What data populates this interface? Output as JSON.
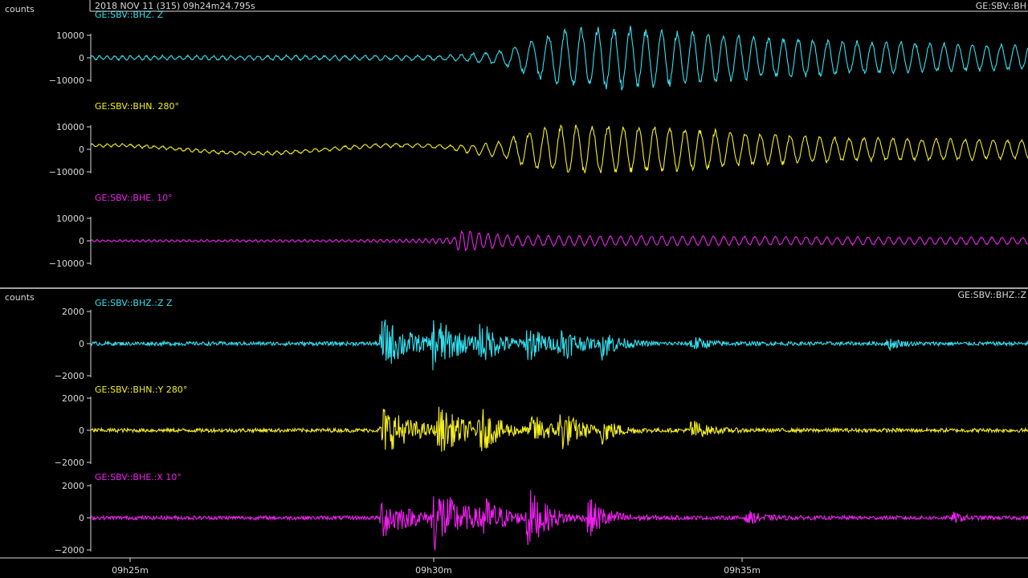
{
  "top_panel": {
    "units_label": "counts",
    "header_left": "2018 NOV 11 (315)  09h24m24.795s",
    "header_right": "GE:SBV::BH"
  },
  "bottom_panel": {
    "units_label": "counts",
    "header_right": "GE:SBV::BHZ.:Z"
  },
  "colors": {
    "background": "#000000",
    "axis": "#d8d8d8",
    "z": "#33e0f0",
    "n": "#f4ee20",
    "e": "#f020f0"
  },
  "chart_data": [
    {
      "type": "line",
      "panel": "top",
      "x_axis": "time",
      "series": [
        {
          "name": "GE:SBV::BHZ. Z",
          "color_key": "z",
          "ylim": [
            -14000,
            14000
          ],
          "yticks": [
            10000,
            0,
            -10000
          ],
          "ytick_labels": [
            "10000",
            "0",
            "−10000"
          ],
          "noise_amplitude": 800,
          "envelope": [
            [
              0,
              800
            ],
            [
              0.38,
              1000
            ],
            [
              0.4,
              1500
            ],
            [
              0.44,
              3000
            ],
            [
              0.46,
              6000
            ],
            [
              0.5,
              11500
            ],
            [
              0.55,
              13000
            ],
            [
              0.6,
              12000
            ],
            [
              0.7,
              9000
            ],
            [
              0.8,
              7000
            ],
            [
              0.9,
              6000
            ],
            [
              1.0,
              5000
            ]
          ],
          "period": [
            [
              0,
              0.008
            ],
            [
              0.4,
              0.012
            ],
            [
              0.46,
              0.018
            ],
            [
              0.7,
              0.016
            ],
            [
              1.0,
              0.015
            ]
          ]
        },
        {
          "name": "GE:SBV::BHN. 280°",
          "color_key": "n",
          "ylim": [
            -14000,
            14000
          ],
          "yticks": [
            10000,
            0,
            -10000
          ],
          "ytick_labels": [
            "10000",
            "0",
            "−10000"
          ],
          "noise_amplitude": 600,
          "long_period_amplitude": 3000,
          "envelope": [
            [
              0,
              600
            ],
            [
              0.38,
              800
            ],
            [
              0.41,
              2000
            ],
            [
              0.44,
              3500
            ],
            [
              0.47,
              8000
            ],
            [
              0.52,
              10500
            ],
            [
              0.6,
              9500
            ],
            [
              0.7,
              7000
            ],
            [
              0.8,
              5000
            ],
            [
              0.9,
              4500
            ],
            [
              1.0,
              4000
            ]
          ],
          "period": [
            [
              0,
              0.008
            ],
            [
              0.4,
              0.012
            ],
            [
              0.46,
              0.017
            ],
            [
              0.7,
              0.016
            ],
            [
              1.0,
              0.015
            ]
          ]
        },
        {
          "name": "GE:SBV::BHE. 10°",
          "color_key": "e",
          "ylim": [
            -14000,
            14000
          ],
          "yticks": [
            10000,
            0,
            -10000
          ],
          "ytick_labels": [
            "10000",
            "0",
            "−10000"
          ],
          "noise_amplitude": 400,
          "envelope": [
            [
              0,
              400
            ],
            [
              0.3,
              500
            ],
            [
              0.36,
              900
            ],
            [
              0.39,
              1500
            ],
            [
              0.36,
              1500
            ],
            [
              0.38,
              4500
            ],
            [
              0.41,
              4000
            ],
            [
              0.45,
              2200
            ],
            [
              0.6,
              2000
            ],
            [
              0.8,
              1600
            ],
            [
              1.0,
              1500
            ]
          ],
          "period": [
            [
              0,
              0.006
            ],
            [
              0.36,
              0.007
            ],
            [
              0.45,
              0.011
            ],
            [
              1.0,
              0.011
            ]
          ]
        }
      ]
    },
    {
      "type": "line",
      "panel": "bottom",
      "x_axis": "time",
      "xticks": [
        "09h25m",
        "09h30m",
        "09h35m"
      ],
      "series": [
        {
          "name": "GE:SBV::BHZ.:Z Z",
          "color_key": "z",
          "ylim": [
            -2200,
            2200
          ],
          "yticks": [
            2000,
            0,
            -2000
          ],
          "ytick_labels": [
            "2000",
            "0",
            "−2000"
          ],
          "noise_amplitude": 120,
          "bursts": [
            [
              0.31,
              1700,
              0.03
            ],
            [
              0.365,
              1600,
              0.025
            ],
            [
              0.415,
              1200,
              0.02
            ],
            [
              0.465,
              1100,
              0.02
            ],
            [
              0.5,
              1000,
              0.02
            ],
            [
              0.545,
              900,
              0.015
            ],
            [
              0.64,
              500,
              0.015
            ],
            [
              0.85,
              450,
              0.01
            ]
          ]
        },
        {
          "name": "GE:SBV::BHN.:Y 280°",
          "color_key": "n",
          "ylim": [
            -2200,
            2200
          ],
          "yticks": [
            2000,
            0,
            -2000
          ],
          "ytick_labels": [
            "2000",
            "0",
            "−2000"
          ],
          "noise_amplitude": 120,
          "bursts": [
            [
              0.31,
              1600,
              0.03
            ],
            [
              0.37,
              1300,
              0.03
            ],
            [
              0.415,
              1100,
              0.02
            ],
            [
              0.47,
              900,
              0.02
            ],
            [
              0.5,
              1200,
              0.02
            ],
            [
              0.545,
              700,
              0.015
            ],
            [
              0.64,
              700,
              0.015
            ]
          ]
        },
        {
          "name": "GE:SBV::BHE.:X 10°",
          "color_key": "e",
          "ylim": [
            -2200,
            2200
          ],
          "yticks": [
            2000,
            0,
            -2000
          ],
          "ytick_labels": [
            "2000",
            "0",
            "−2000"
          ],
          "noise_amplitude": 120,
          "bursts": [
            [
              0.31,
              1300,
              0.03
            ],
            [
              0.365,
              2000,
              0.03
            ],
            [
              0.415,
              1200,
              0.02
            ],
            [
              0.465,
              1900,
              0.02
            ],
            [
              0.53,
              1200,
              0.02
            ],
            [
              0.7,
              400,
              0.015
            ],
            [
              0.92,
              300,
              0.01
            ]
          ]
        }
      ]
    }
  ]
}
